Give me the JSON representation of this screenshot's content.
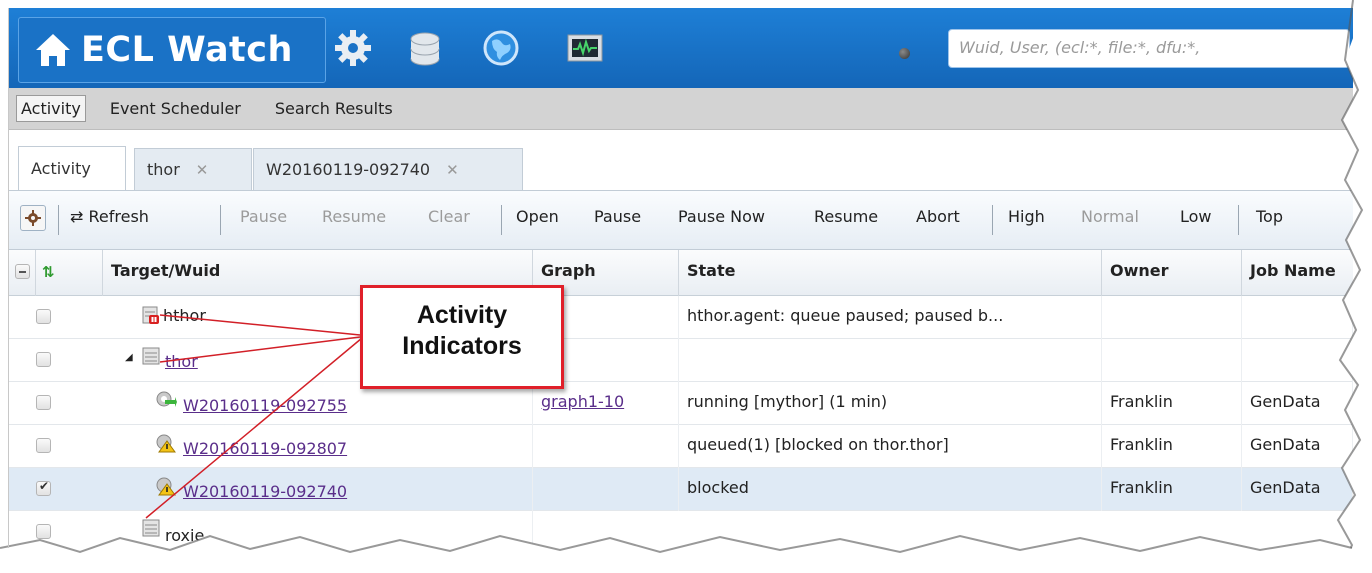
{
  "app": {
    "title": "ECL Watch",
    "search_placeholder": "Wuid, User, (ecl:*, file:*, dfu:*,",
    "icons": [
      "home-icon",
      "gear-icon",
      "database-icon",
      "globe-icon",
      "monitor-icon"
    ]
  },
  "menu": {
    "items": [
      {
        "label": "Activity",
        "active": true
      },
      {
        "label": "Event Scheduler",
        "active": false
      },
      {
        "label": "Search Results",
        "active": false
      }
    ]
  },
  "tabs": [
    {
      "label": "Activity",
      "closable": false,
      "active": true
    },
    {
      "label": "thor",
      "closable": true,
      "active": false
    },
    {
      "label": "W20160119-092740",
      "closable": true,
      "active": false
    }
  ],
  "toolbar": {
    "refresh": "Refresh",
    "pause_disabled": "Pause",
    "resume_disabled": "Resume",
    "clear": "Clear",
    "open": "Open",
    "pause": "Pause",
    "pause_now": "Pause Now",
    "resume": "Resume",
    "abort": "Abort",
    "high": "High",
    "normal": "Normal",
    "low": "Low",
    "top": "Top"
  },
  "grid": {
    "columns": [
      "Target/Wuid",
      "Graph",
      "State",
      "Owner",
      "Job Name"
    ],
    "rows": [
      {
        "target": "hthor",
        "link": false,
        "graph": "",
        "state": "hthor.agent: queue paused; paused b...",
        "owner": "",
        "job": "",
        "checked": false,
        "icon": "server-paused-icon"
      },
      {
        "target": "thor",
        "link": true,
        "graph": "",
        "state": "",
        "owner": "",
        "job": "",
        "checked": false,
        "icon": "server-icon"
      },
      {
        "target": "W20160119-092755",
        "link": true,
        "graph": "graph1-10",
        "state": "running [mythor] (1 min)",
        "owner": "Franklin",
        "job": "GenData",
        "checked": false,
        "icon": "running-gear-icon"
      },
      {
        "target": "W20160119-092807",
        "link": true,
        "graph": "",
        "state": "queued(1) [blocked on thor.thor]",
        "owner": "Franklin",
        "job": "GenData",
        "checked": false,
        "icon": "warning-gear-icon"
      },
      {
        "target": "W20160119-092740",
        "link": true,
        "graph": "",
        "state": "blocked",
        "owner": "Franklin",
        "job": "GenData",
        "checked": true,
        "icon": "warning-gear-icon"
      },
      {
        "target": "roxie",
        "link": false,
        "graph": "",
        "state": "",
        "owner": "",
        "job": "",
        "checked": false,
        "icon": "server-icon"
      }
    ]
  },
  "callout": {
    "line1": "Activity",
    "line2": "Indicators",
    "color": "#e0202a"
  }
}
